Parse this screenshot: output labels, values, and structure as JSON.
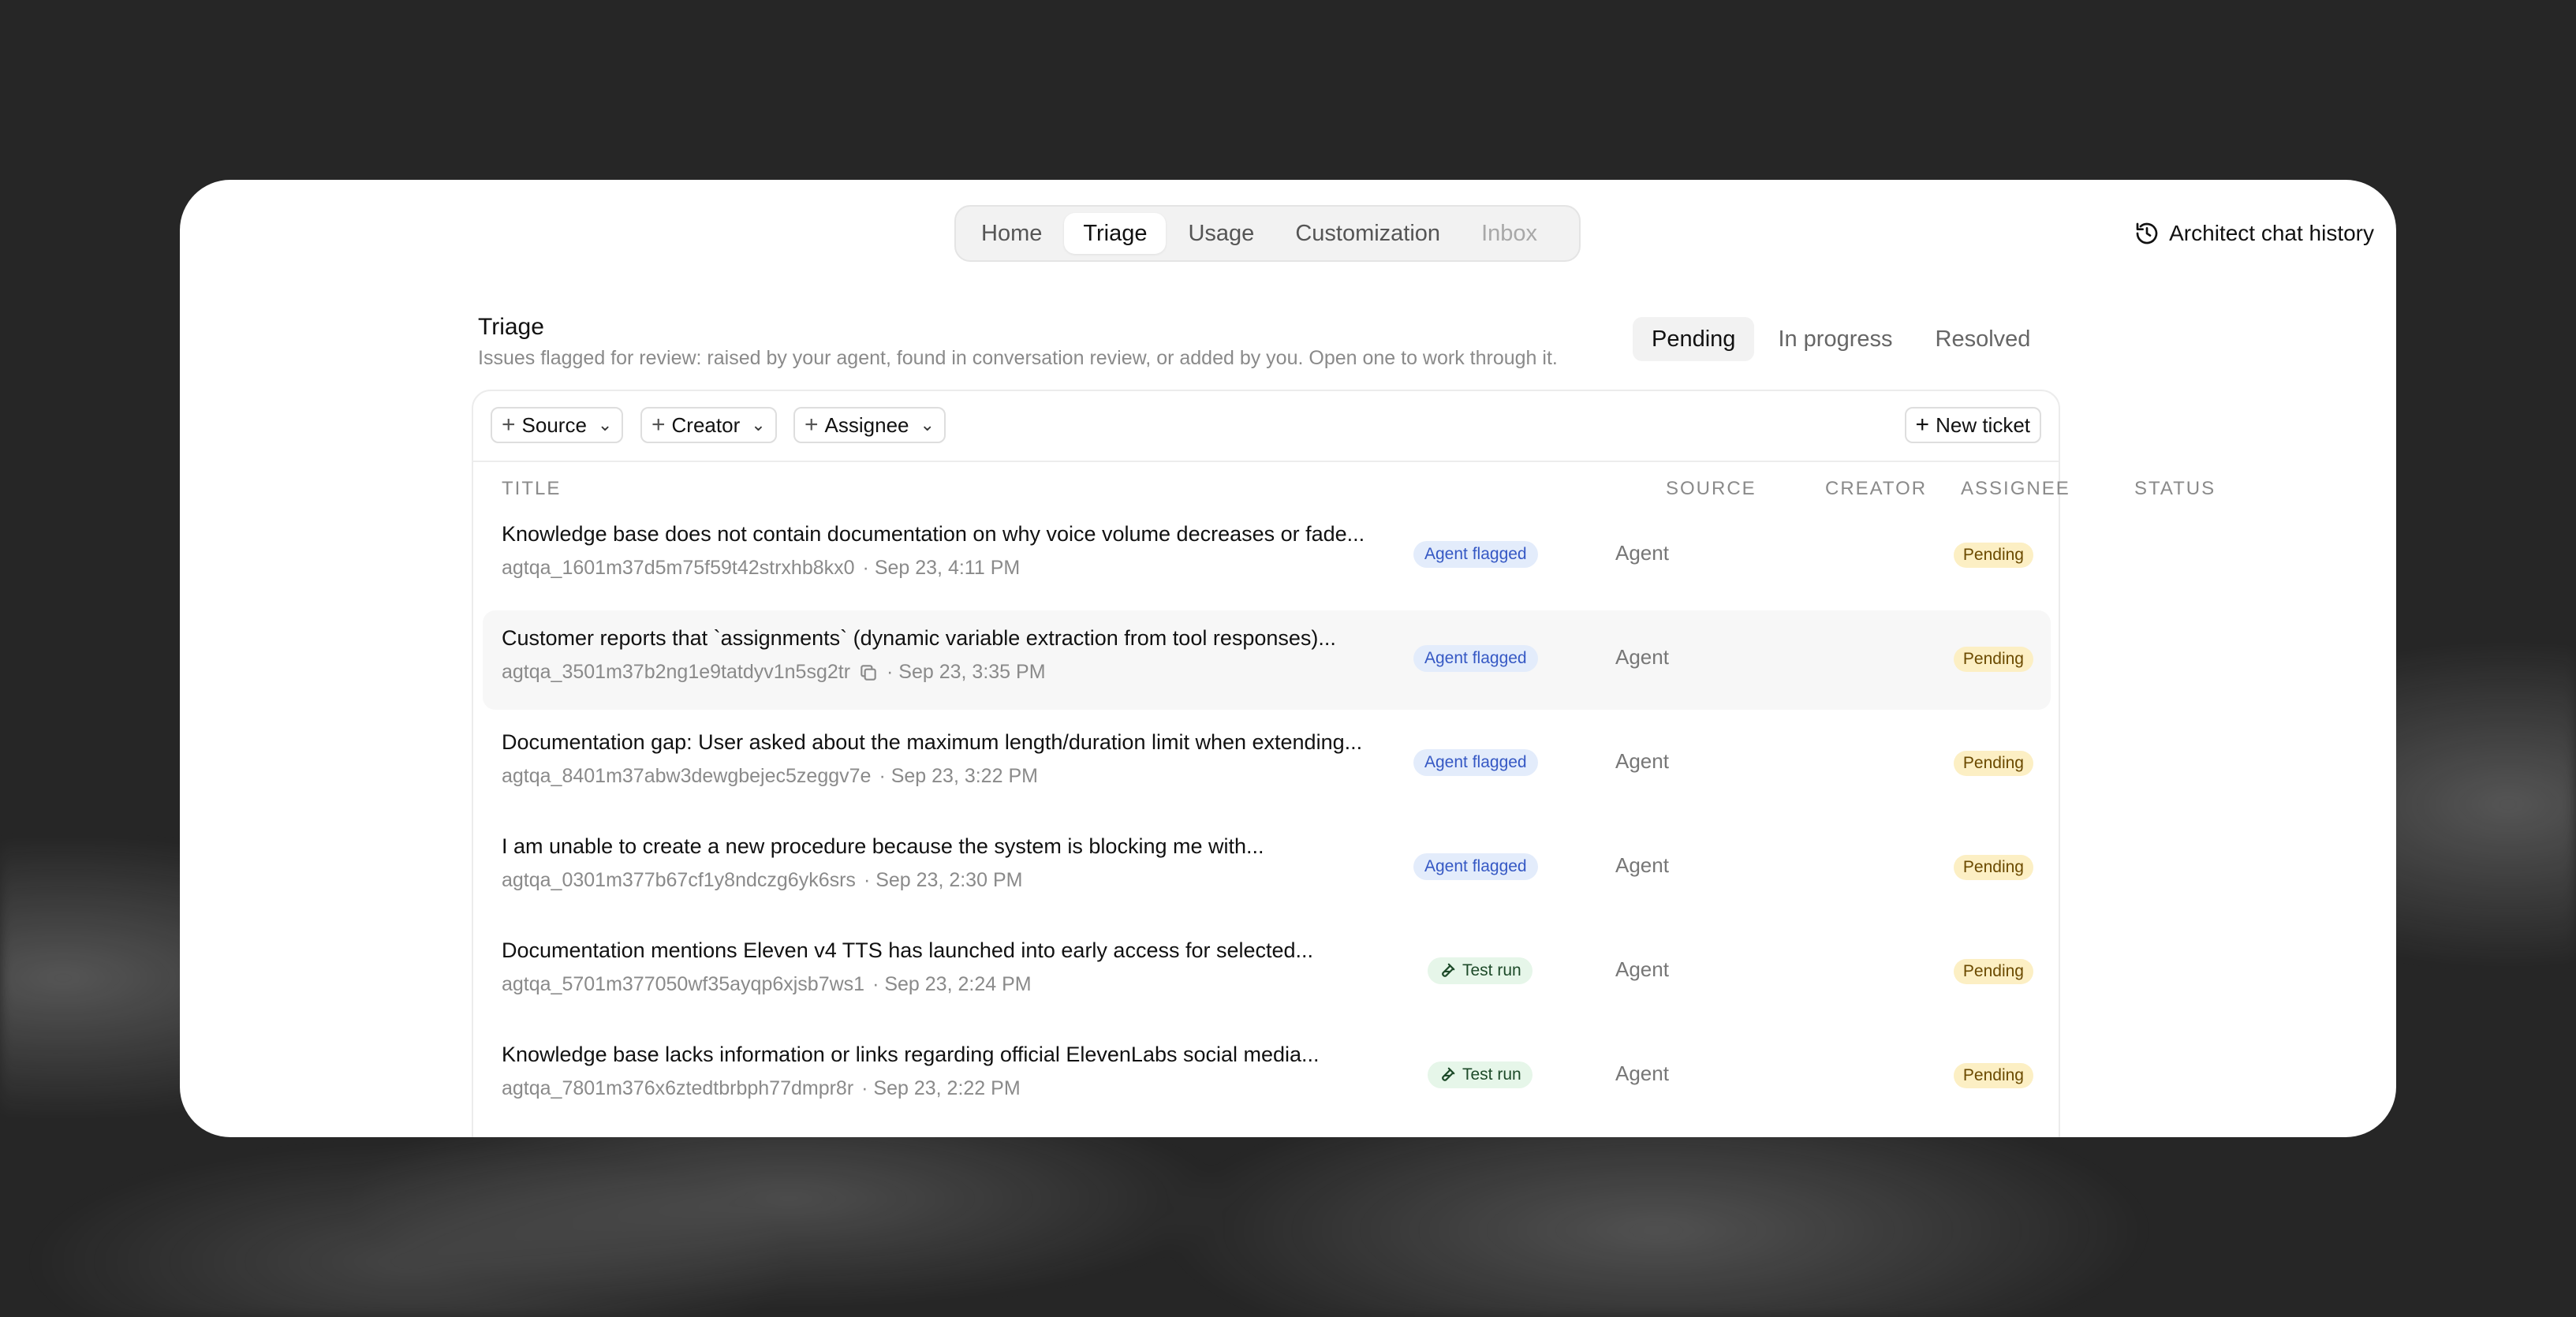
{
  "nav": {
    "tabs": [
      "Home",
      "Triage",
      "Usage",
      "Customization",
      "Inbox"
    ],
    "active": "Triage"
  },
  "history": {
    "label": "Architect chat history",
    "icon": "history-icon"
  },
  "page": {
    "title": "Triage",
    "subtitle": "Issues flagged for review: raised by your agent, found in conversation review, or added by you. Open one to work through it."
  },
  "status_tabs": [
    "Pending",
    "In progress",
    "Resolved"
  ],
  "filters": {
    "source": "Source",
    "creator": "Creator",
    "assignee": "Assignee",
    "new_ticket": "New ticket"
  },
  "columns": {
    "title": "TITLE",
    "source": "SOURCE",
    "creator": "CREATOR",
    "assignee": "ASSIGNEE",
    "status": "STATUS"
  },
  "rows": [
    {
      "title": "Knowledge base does not contain documentation on why voice volume decreases or fade...",
      "id": "agtqa_1601m37d5m75f59t42strxhb8kx0",
      "time": "· Sep 23, 4:11 PM",
      "source": "Agent flagged",
      "creator": "Agent",
      "status": "Pending"
    },
    {
      "title": "Customer reports that `assignments` (dynamic variable extraction from tool responses)...",
      "id": "agtqa_3501m37b2ng1e9tatdyv1n5sg2tr",
      "time": "· Sep 23, 3:35 PM",
      "source": "Agent flagged",
      "creator": "Agent",
      "status": "Pending"
    },
    {
      "title": "Documentation gap: User asked about the maximum length/duration limit when extending...",
      "id": "agtqa_8401m37abw3dewgbejec5zeggv7e",
      "time": "· Sep 23, 3:22 PM",
      "source": "Agent flagged",
      "creator": "Agent",
      "status": "Pending"
    },
    {
      "title": "I am unable to create a new procedure because the system is blocking me with...",
      "id": "agtqa_0301m377b67cf1y8ndczg6yk6srs",
      "time": "· Sep 23, 2:30 PM",
      "source": "Agent flagged",
      "creator": "Agent",
      "status": "Pending"
    },
    {
      "title": "Documentation mentions Eleven v4 TTS has launched into early access for selected...",
      "id": "agtqa_5701m377050wf35ayqp6xjsb7ws1",
      "time": "· Sep 23, 2:24 PM",
      "source": "Test run",
      "creator": "Agent",
      "status": "Pending"
    },
    {
      "title": "Knowledge base lacks information or links regarding official ElevenLabs social media...",
      "id": "agtqa_7801m376x6ztedtbrbph77dmpr8r",
      "time": "· Sep 23, 2:22 PM",
      "source": "Test run",
      "creator": "Agent",
      "status": "Pending"
    }
  ]
}
